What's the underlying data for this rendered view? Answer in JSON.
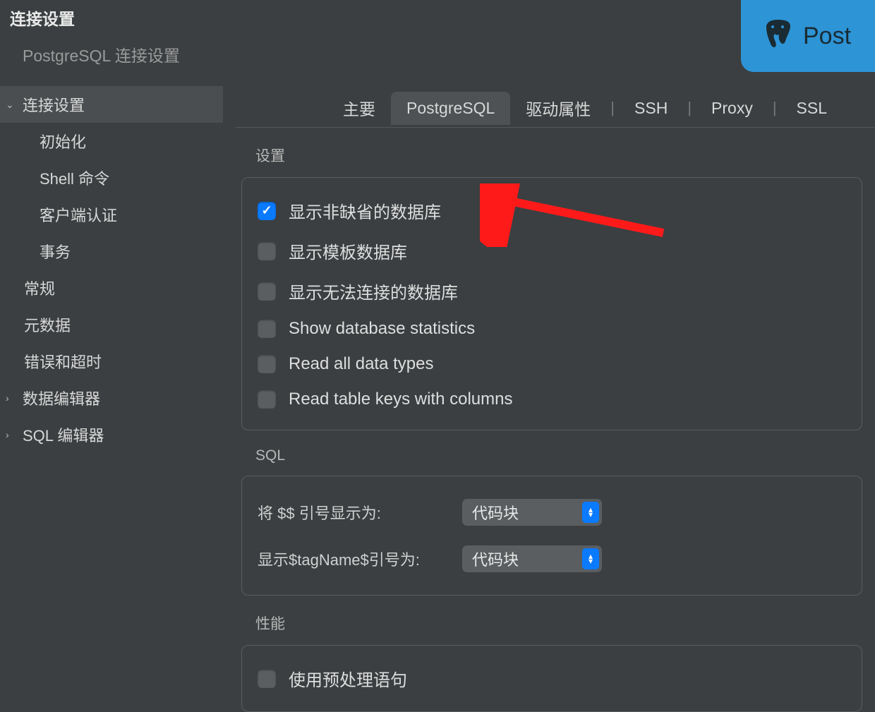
{
  "header": {
    "title": "连接设置",
    "subtitle": "PostgreSQL 连接设置",
    "logo_text": "Post"
  },
  "sidebar": {
    "items": [
      {
        "label": "连接设置",
        "expanded": true,
        "level": 0
      },
      {
        "label": "初始化",
        "level": 1
      },
      {
        "label": "Shell 命令",
        "level": 1
      },
      {
        "label": "客户端认证",
        "level": 1
      },
      {
        "label": "事务",
        "level": 1
      },
      {
        "label": "常规",
        "level": 0
      },
      {
        "label": "元数据",
        "level": 0
      },
      {
        "label": "错误和超时",
        "level": 0
      },
      {
        "label": "数据编辑器",
        "expandable": true,
        "level": 0
      },
      {
        "label": "SQL 编辑器",
        "expandable": true,
        "level": 0
      }
    ]
  },
  "tabs": [
    {
      "label": "主要"
    },
    {
      "label": "PostgreSQL",
      "active": true
    },
    {
      "label": "驱动属性"
    },
    {
      "label": "SSH",
      "sep": true
    },
    {
      "label": "Proxy",
      "sep": true
    },
    {
      "label": "SSL",
      "sep": true
    }
  ],
  "settings_section": {
    "label": "设置",
    "checks": [
      {
        "label": "显示非缺省的数据库",
        "checked": true
      },
      {
        "label": "显示模板数据库",
        "checked": false
      },
      {
        "label": "显示无法连接的数据库",
        "checked": false
      },
      {
        "label": "Show database statistics",
        "checked": false
      },
      {
        "label": "Read all data types",
        "checked": false
      },
      {
        "label": "Read table keys with columns",
        "checked": false
      }
    ]
  },
  "sql_section": {
    "label": "SQL",
    "rows": [
      {
        "label": "将 $$ 引号显示为:",
        "value": "代码块"
      },
      {
        "label": "显示$tagName$引号为:",
        "value": "代码块"
      }
    ]
  },
  "perf_section": {
    "label": "性能",
    "checks": [
      {
        "label": "使用预处理语句",
        "checked": false
      }
    ]
  }
}
